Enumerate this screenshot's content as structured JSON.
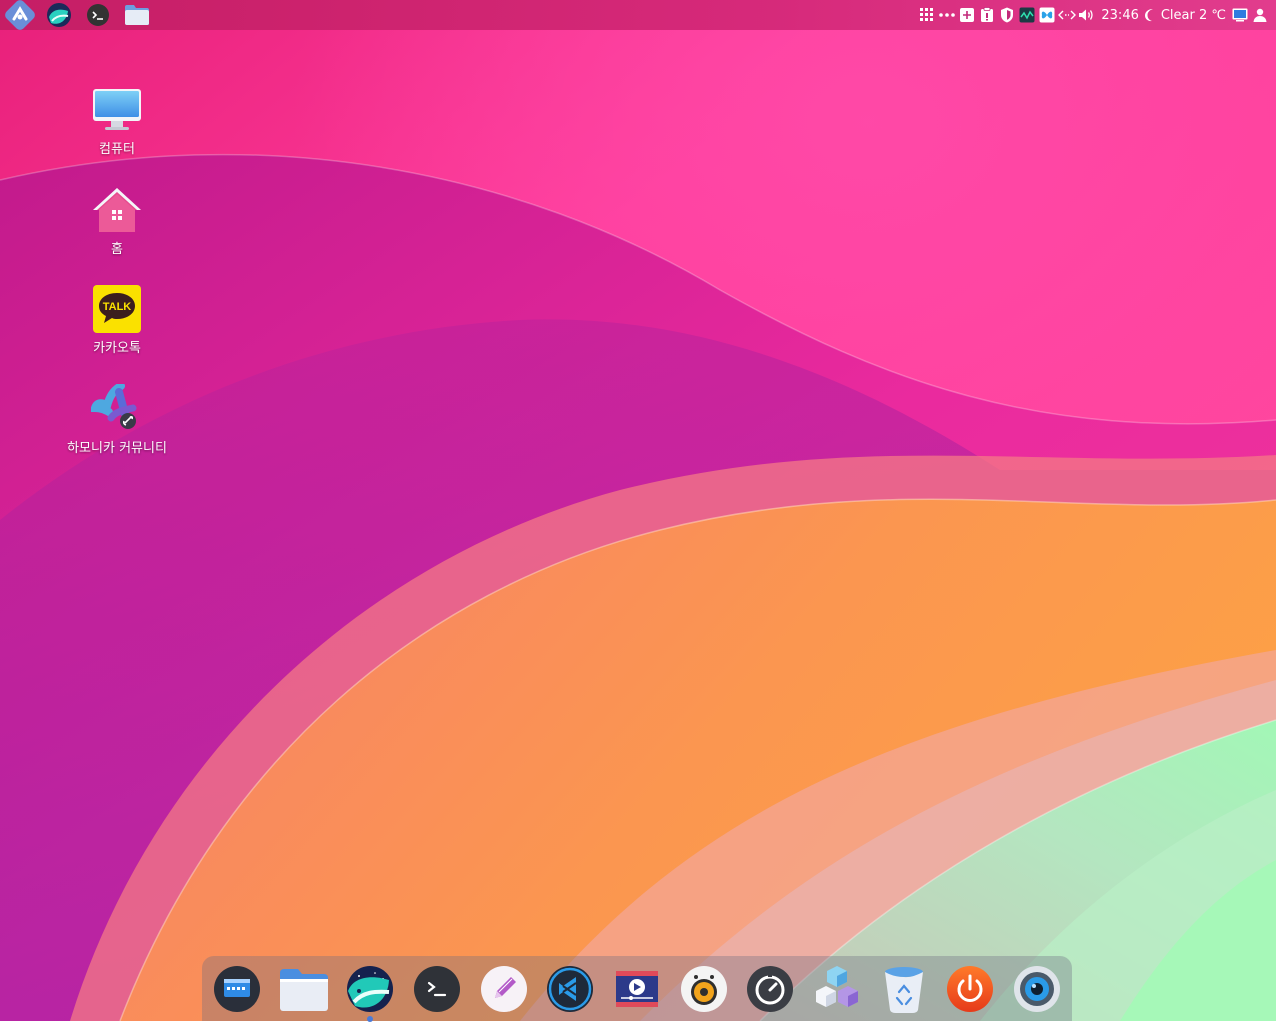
{
  "top_panel": {
    "launchers": [
      {
        "name": "harmonica-menu-icon"
      },
      {
        "name": "whale-browser-icon"
      },
      {
        "name": "terminal-icon"
      },
      {
        "name": "file-manager-icon"
      }
    ],
    "tray": {
      "clock": "23:46",
      "weather": "Clear 2 ℃"
    }
  },
  "desktop": {
    "icons": [
      {
        "label": "컴퓨터",
        "icon": "computer-icon"
      },
      {
        "label": "홈",
        "icon": "home-folder-icon"
      },
      {
        "label": "카카오톡",
        "icon": "kakaotalk-icon",
        "badge": "TALK"
      },
      {
        "label": "하모니카 커뮤니티",
        "icon": "harmonica-community-icon"
      }
    ]
  },
  "dock": {
    "items": [
      {
        "name": "show-desktop-icon"
      },
      {
        "name": "files-icon"
      },
      {
        "name": "whale-browser-icon",
        "active": true
      },
      {
        "name": "terminal-icon"
      },
      {
        "name": "text-editor-icon"
      },
      {
        "name": "vscode-icon"
      },
      {
        "name": "video-editor-icon"
      },
      {
        "name": "audio-player-icon"
      },
      {
        "name": "system-monitor-icon"
      },
      {
        "name": "software-center-icon"
      },
      {
        "name": "trash-icon"
      },
      {
        "name": "power-icon"
      },
      {
        "name": "webcam-icon"
      }
    ]
  },
  "colors": {
    "wallpaper_pink": "#ff3fa0",
    "wallpaper_magenta": "#c928a8",
    "wallpaper_orange": "#fb9a50",
    "wallpaper_mint": "#a8f5b8",
    "panel": "#cf2a78",
    "dock_active_dot": "#4a7bd8"
  }
}
